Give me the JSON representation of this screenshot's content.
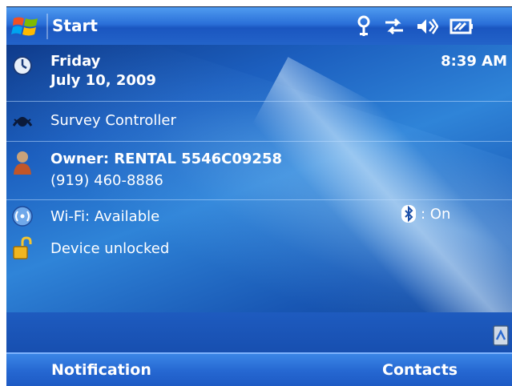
{
  "titlebar": {
    "title": "Start",
    "status_icons": [
      "antenna-icon",
      "data-connection-icon",
      "speaker-icon",
      "battery-icon"
    ]
  },
  "today": {
    "date": {
      "day": "Friday",
      "date": "July 10, 2009",
      "time": "8:39 AM",
      "icon": "clock-icon"
    },
    "survey": {
      "label": "Survey Controller",
      "icon": "survey-icon"
    },
    "owner": {
      "name": "Owner: RENTAL 5546C09258",
      "phone": "(919) 460-8886",
      "icon": "owner-icon"
    },
    "wireless": {
      "wifi": "Wi-Fi: Available",
      "bluetooth": ": On",
      "wifi_icon": "wifi-icon",
      "bluetooth_icon": "bluetooth-icon"
    },
    "lock": {
      "label": "Device unlocked",
      "icon": "padlock-icon"
    }
  },
  "softkeys": {
    "left": "Notification",
    "right": "Contacts"
  }
}
